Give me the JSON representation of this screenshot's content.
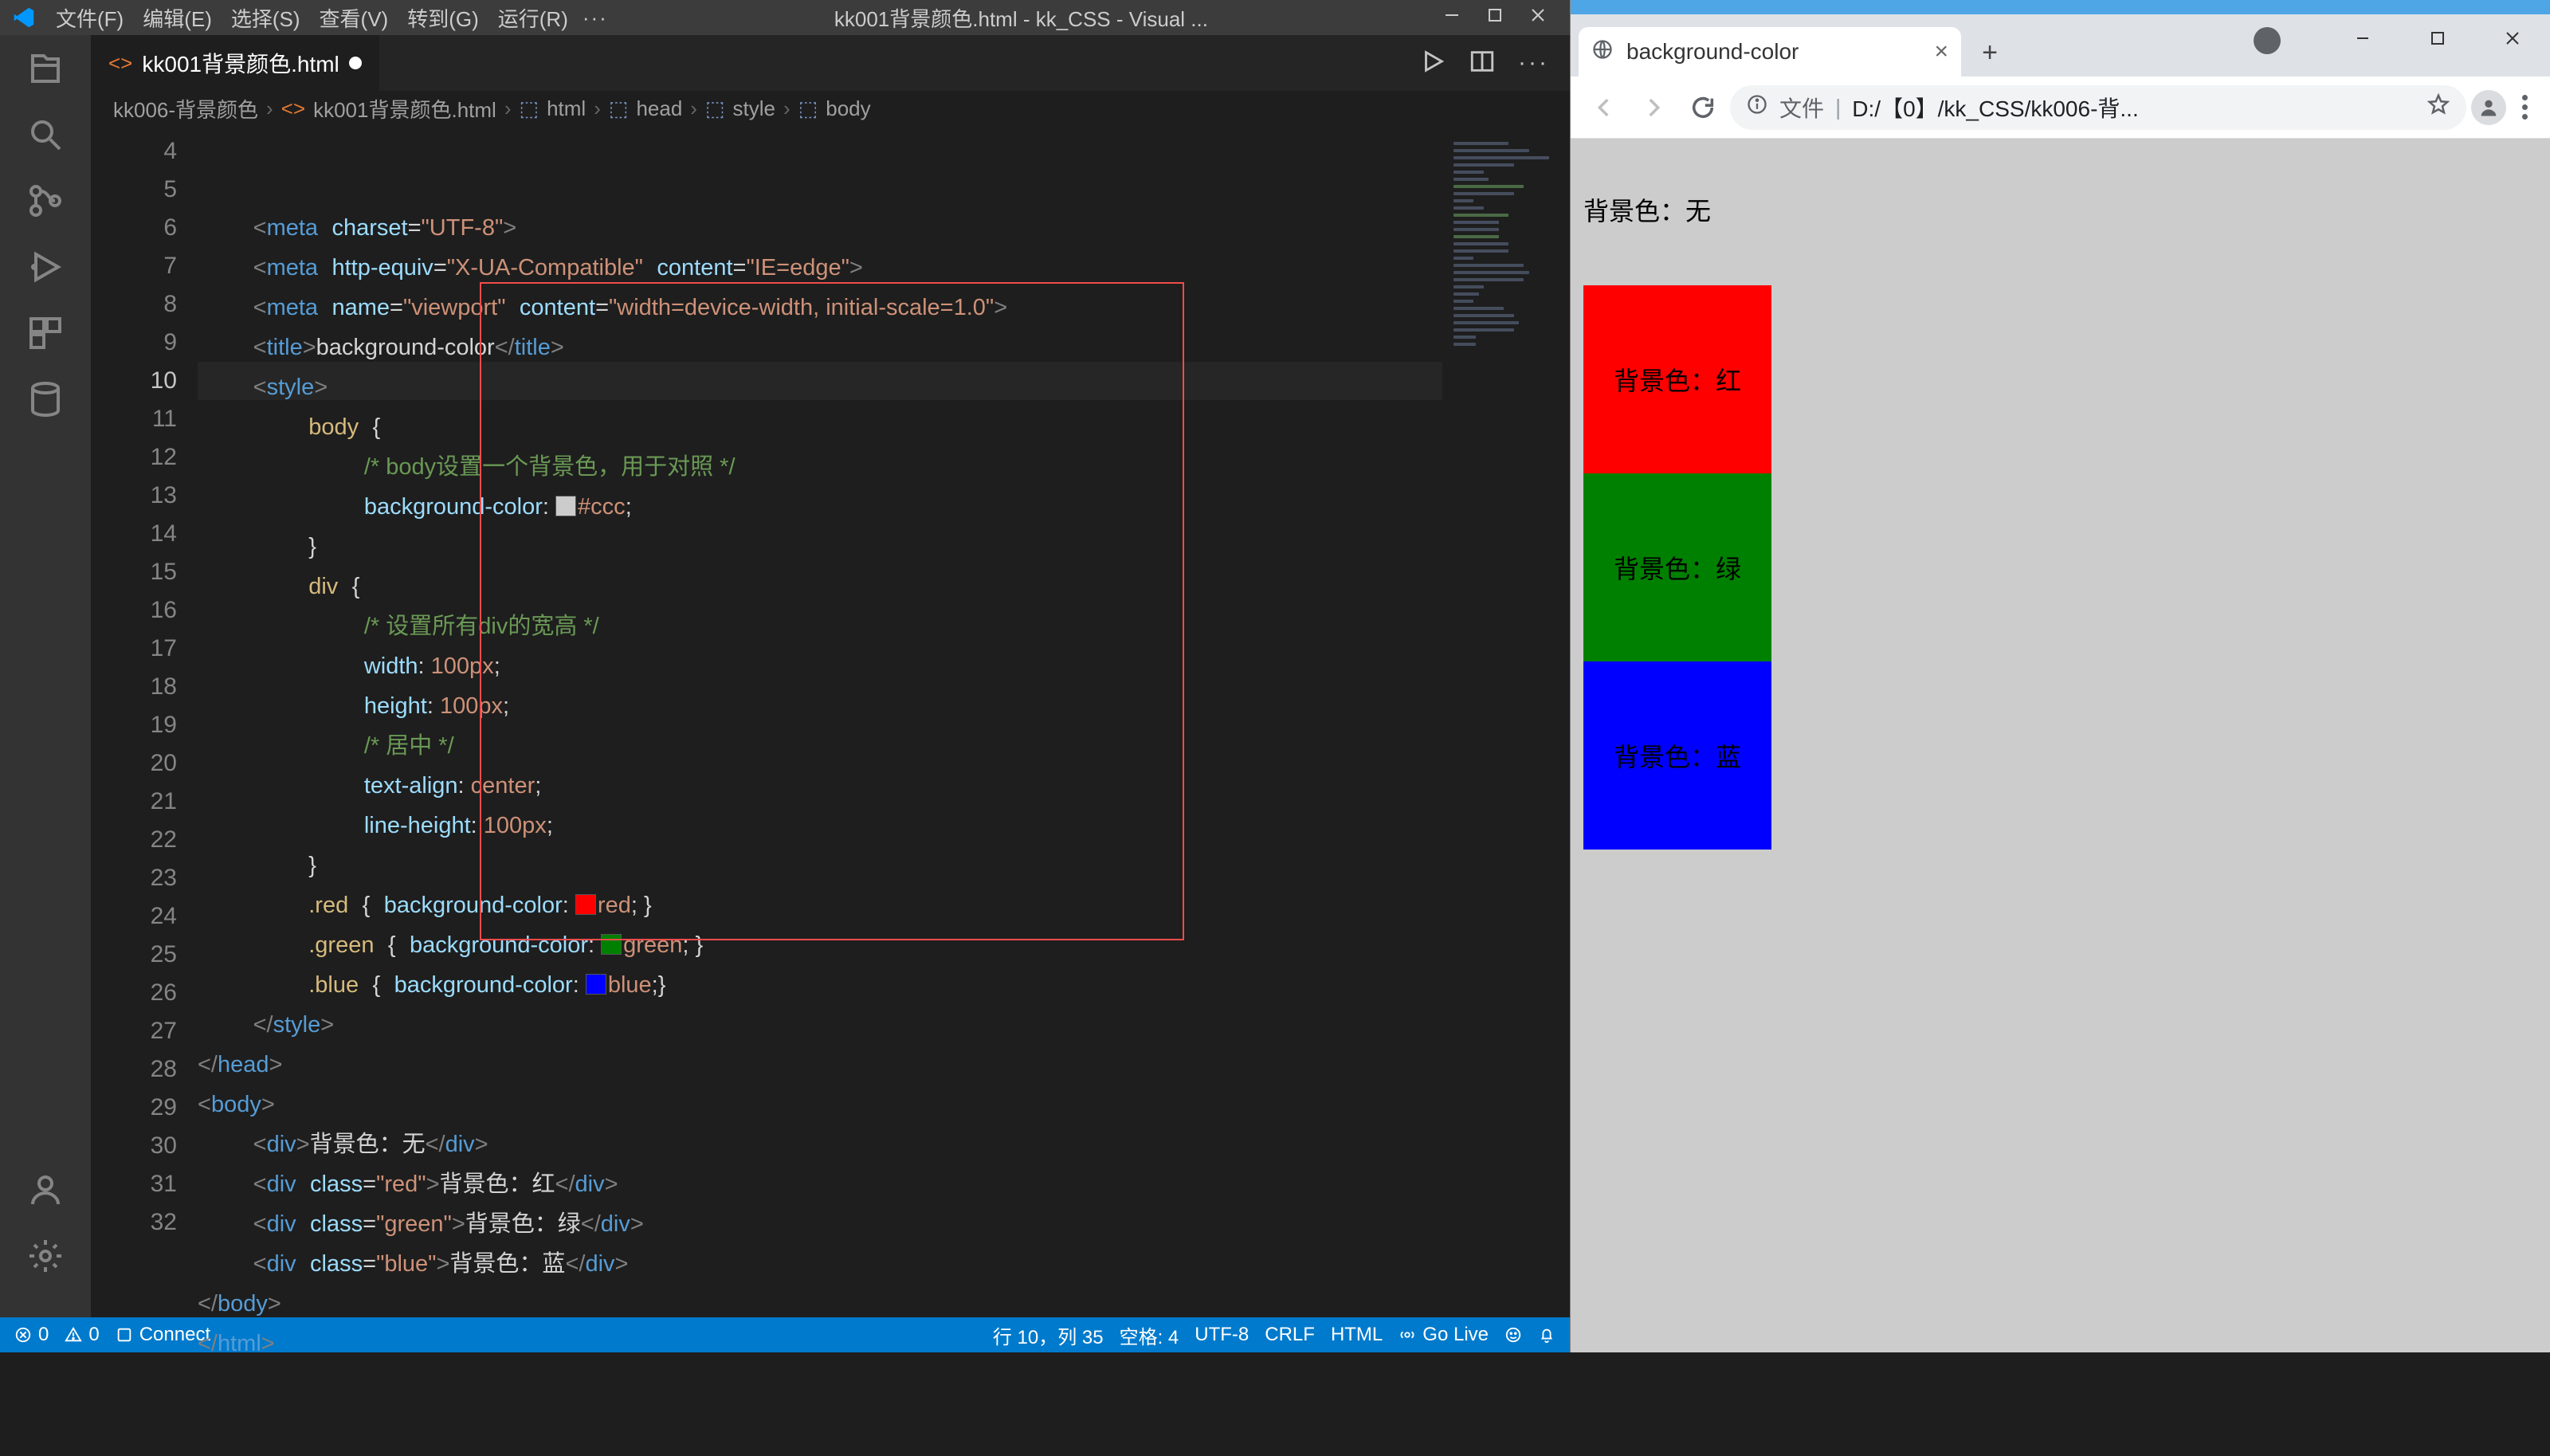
{
  "vscode": {
    "menu": [
      "文件(F)",
      "编辑(E)",
      "选择(S)",
      "查看(V)",
      "转到(G)",
      "运行(R)"
    ],
    "menu_more": "···",
    "window_title": "kk001背景颜色.html - kk_CSS - Visual ...",
    "tab_label": "kk001背景颜色.html",
    "breadcrumb": [
      "kk006-背景颜色",
      "kk001背景颜色.html",
      "html",
      "head",
      "style",
      "body"
    ],
    "lines": [
      "4",
      "5",
      "6",
      "7",
      "8",
      "9",
      "10",
      "11",
      "12",
      "13",
      "14",
      "15",
      "16",
      "17",
      "18",
      "19",
      "20",
      "21",
      "22",
      "23",
      "24",
      "25",
      "26",
      "27",
      "28",
      "29",
      "30",
      "31",
      "32"
    ],
    "code": {
      "l4": "meta",
      "l4a": "charset",
      "l4v": "\"UTF-8\"",
      "l5": "meta",
      "l5a": "http-equiv",
      "l5v": "\"X-UA-Compatible\"",
      "l5a2": "content",
      "l5v2": "\"IE=edge\"",
      "l6": "meta",
      "l6a": "name",
      "l6v": "\"viewport\"",
      "l6a2": "content",
      "l6v2": "\"width=device-width, initial-scale=1.0\"",
      "l7t": "title",
      "l7txt": "background-color",
      "style": "style",
      "body_sel": "body",
      "cmt1": "/* body设置一个背景色，用于对照 */",
      "bgprop": "background-color",
      "bgval": "#ccc",
      "div_sel": "div",
      "cmt2": "/* 设置所有div的宽高 */",
      "w": "width",
      "wv": "100px",
      "h": "height",
      "hv": "100px",
      "cmt3": "/* 居中 */",
      "ta": "text-align",
      "tav": "center",
      "lh": "line-height",
      "lhv": "100px",
      "redc": "red",
      "greenc": "green",
      "bluec": "blue",
      "head": "head",
      "bodyt": "body",
      "html": "html",
      "d1": "背景色：无",
      "d2": "背景色：红",
      "d3": "背景色：绿",
      "d4": "背景色：蓝"
    },
    "status": {
      "errors": "0",
      "warnings": "0",
      "connect": "Connect",
      "cursor": "行 10，列 35",
      "spaces": "空格: 4",
      "enc": "UTF-8",
      "eol": "CRLF",
      "lang": "HTML",
      "golive": "Go Live"
    }
  },
  "browser": {
    "tab_title": "background-color",
    "url_label": "文件",
    "url_sep": "|",
    "url": "D:/【0】/kk_CSS/kk006-背...",
    "page": {
      "none": "背景色：无",
      "red": "背景色：红",
      "green": "背景色：绿",
      "blue": "背景色：蓝"
    }
  }
}
